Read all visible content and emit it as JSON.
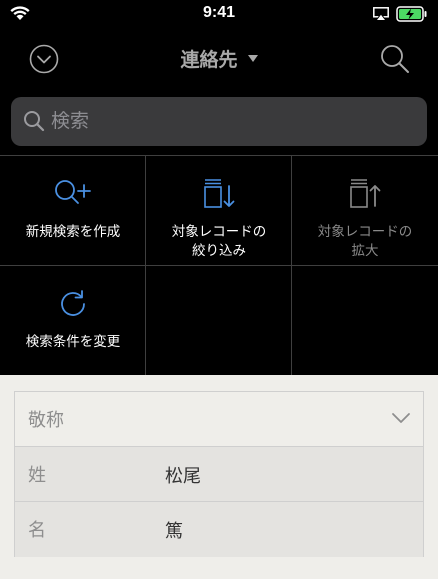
{
  "status_bar": {
    "time": "9:41"
  },
  "nav": {
    "title": "連絡先"
  },
  "search": {
    "placeholder": "検索"
  },
  "actions": [
    {
      "label": "新規検索を作成",
      "icon": "search-plus-icon",
      "enabled": true
    },
    {
      "label": "対象レコードの\n絞り込み",
      "icon": "narrow-records-icon",
      "enabled": true
    },
    {
      "label": "対象レコードの\n拡大",
      "icon": "extend-records-icon",
      "enabled": false
    },
    {
      "label": "検索条件を変更",
      "icon": "refresh-icon",
      "enabled": true
    }
  ],
  "form": {
    "honorific": {
      "label": "敬称",
      "value": ""
    },
    "last_name": {
      "label": "姓",
      "value": "松尾"
    },
    "first_name": {
      "label": "名",
      "value": "篤"
    }
  },
  "colors": {
    "accent": "#4a90e2",
    "disabled": "#8a8a8a",
    "background": "#000000",
    "form_background": "#efeeea"
  }
}
